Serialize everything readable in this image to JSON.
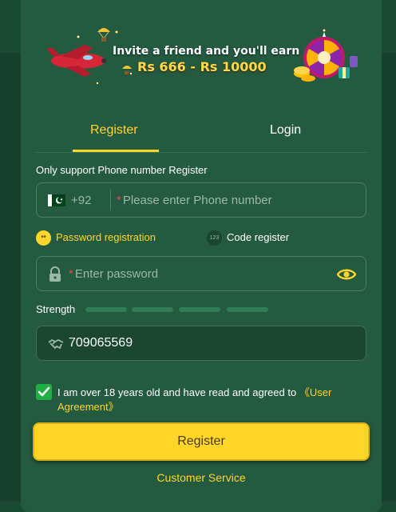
{
  "banner": {
    "line1": "Invite a friend and you'll earn",
    "line2": "Rs 666 - Rs 10000"
  },
  "tabs": [
    {
      "label": "Register",
      "active": true
    },
    {
      "label": "Login",
      "active": false
    }
  ],
  "form": {
    "support_text": "Only support Phone number Register",
    "phone": {
      "country_code": "+92",
      "required_mark": "*",
      "placeholder": "Please enter Phone number",
      "flag_icon": "pakistan-flag-icon"
    },
    "modes": {
      "password_label": "Password registration",
      "password_icon_text": "**",
      "code_label": "Code register",
      "code_icon_text": "123"
    },
    "password": {
      "required_mark": "*",
      "placeholder": "Enter password",
      "lock_icon": "lock-icon",
      "eye_icon": "eye-icon"
    },
    "strength_label": "Strength",
    "invite": {
      "value": "709065569",
      "icon": "handshake-icon"
    },
    "agreement": {
      "checked": true,
      "text": "I am over 18 years old and have read and agreed to",
      "link": "《User Agreement》"
    },
    "register_button": "Register",
    "customer_service": "Customer Service"
  },
  "colors": {
    "accent": "#ffd52a",
    "panel": "#245a3f",
    "background": "#1b4a34",
    "check": "#1fae45"
  }
}
